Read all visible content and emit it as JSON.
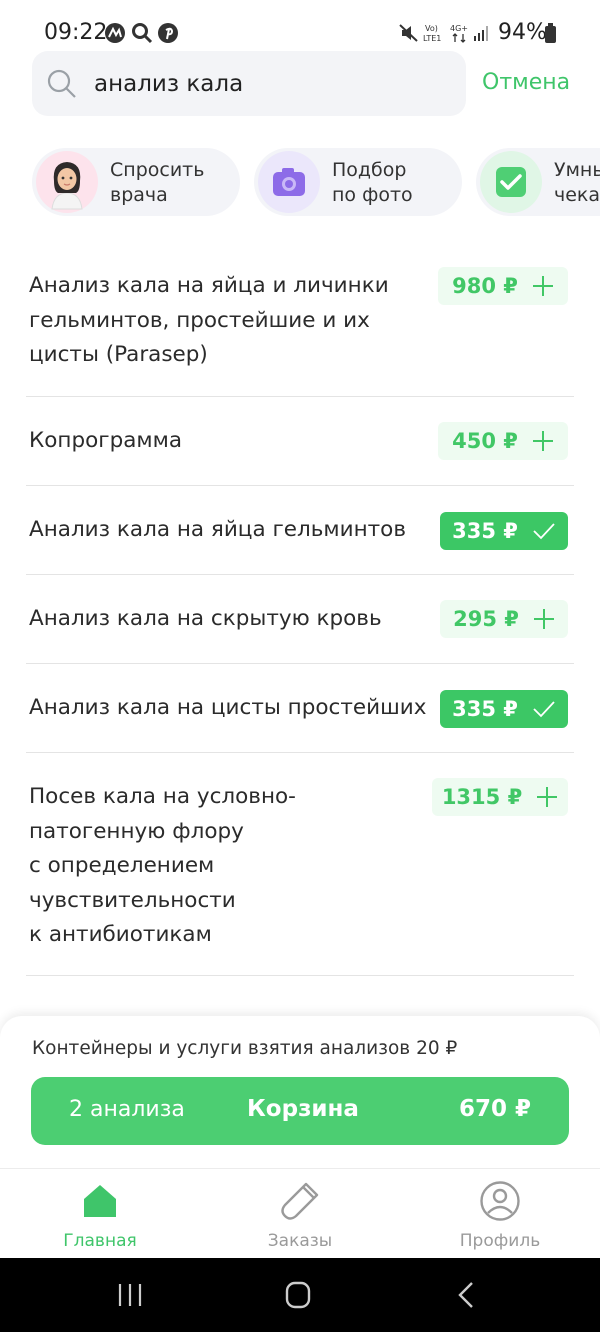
{
  "status_bar": {
    "time": "09:22",
    "battery": "94%",
    "network_icons": [
      "mute-icon",
      "volte-icon",
      "4g-icon",
      "signal-icon",
      "battery-icon"
    ]
  },
  "search": {
    "value": "анализ кала",
    "cancel_label": "Отмена"
  },
  "chips": [
    {
      "label": "Спросить\nврача",
      "icon": "doctor-avatar"
    },
    {
      "label": "Подбор\nпо фото",
      "icon": "camera-icon"
    },
    {
      "label": "Умны\nчека",
      "icon": "checkbox-icon"
    }
  ],
  "results": [
    {
      "name": "Анализ кала на яйца и личинки\nгельминтов, простейшие и их\nцисты (Parasep)",
      "price": "980 ₽",
      "in_cart": false
    },
    {
      "name": "Копрограмма",
      "price": "450 ₽",
      "in_cart": false
    },
    {
      "name": "Анализ кала на яйца гельминтов",
      "price": "335 ₽",
      "in_cart": true
    },
    {
      "name": "Анализ кала на скрытую кровь",
      "price": "295 ₽",
      "in_cart": false
    },
    {
      "name": "Анализ кала на цисты простейших",
      "price": "335 ₽",
      "in_cart": true
    },
    {
      "name": "Посев кала на условно-\nпатогенную флору\nс определением\nчувствительности\nк антибиотикам",
      "price": "1315 ₽",
      "in_cart": false
    }
  ],
  "cart_sheet": {
    "note": "Контейнеры и услуги взятия анализов 20 ₽",
    "count_label": "2 анализа",
    "title": "Корзина",
    "total": "670 ₽"
  },
  "tabs": [
    {
      "label": "Главная",
      "icon": "home-icon",
      "active": true
    },
    {
      "label": "Заказы",
      "icon": "test-tube-icon",
      "active": false
    },
    {
      "label": "Профиль",
      "icon": "profile-icon",
      "active": false
    }
  ],
  "colors": {
    "accent": "#3fc56a",
    "price_bg": "#eefbf1",
    "cart_bg": "#4cce72"
  }
}
